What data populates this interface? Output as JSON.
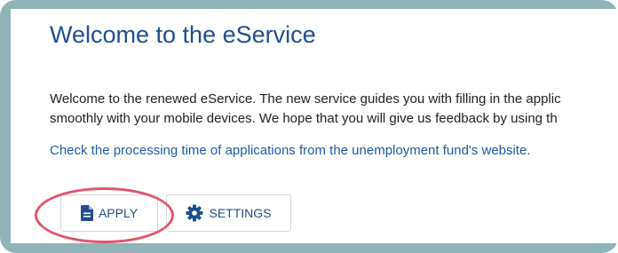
{
  "page": {
    "title": "Welcome to the eService",
    "intro_line1": "Welcome to the renewed eService. The new service guides you with filling in the applic",
    "intro_line2": "smoothly with your mobile devices. We hope that you will give us feedback by using th",
    "link_text": "Check the processing time of applications from the unemployment fund's website."
  },
  "actions": {
    "apply": {
      "label": "APPLY",
      "icon": "document-icon"
    },
    "settings": {
      "label": "SETTINGS",
      "icon": "gear-icon"
    }
  },
  "colors": {
    "frame": "#8fb3b6",
    "title": "#1f4e8c",
    "link": "#1f5aa6",
    "highlight": "#e2546c"
  }
}
